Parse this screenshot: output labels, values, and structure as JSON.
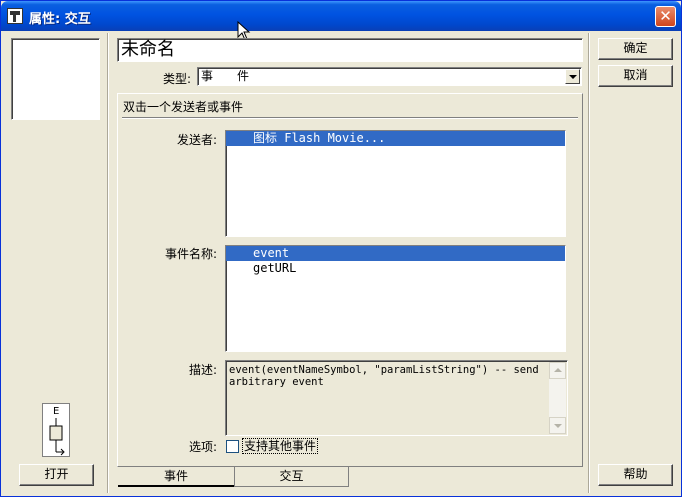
{
  "window": {
    "title": "属性: 交互"
  },
  "dialog": {
    "name_value": "未命名",
    "type_label": "类型:",
    "type_value": "事　　件",
    "ok_label": "确定",
    "cancel_label": "取消",
    "help_label": "帮助",
    "open_label": "打开"
  },
  "panel": {
    "header": "双击一个发送者或事件",
    "sender_label": "发送者:",
    "senders": [
      "图标 Flash Movie..."
    ],
    "event_label": "事件名称:",
    "events": [
      "event",
      "getURL"
    ],
    "desc_label": "描述:",
    "description": "event(eventNameSymbol, \"paramListString\") -- send arbitrary event",
    "options_label": "选项:",
    "option_checkbox_label": "支持其他事件",
    "option_checked": false
  },
  "tabs": [
    {
      "label": "事件",
      "active": true
    },
    {
      "label": "交互",
      "active": false
    }
  ],
  "glyph_letter": "E",
  "colors": {
    "selection": "#316ac5",
    "titlebar": "#0053e1",
    "face": "#ece9d8"
  }
}
